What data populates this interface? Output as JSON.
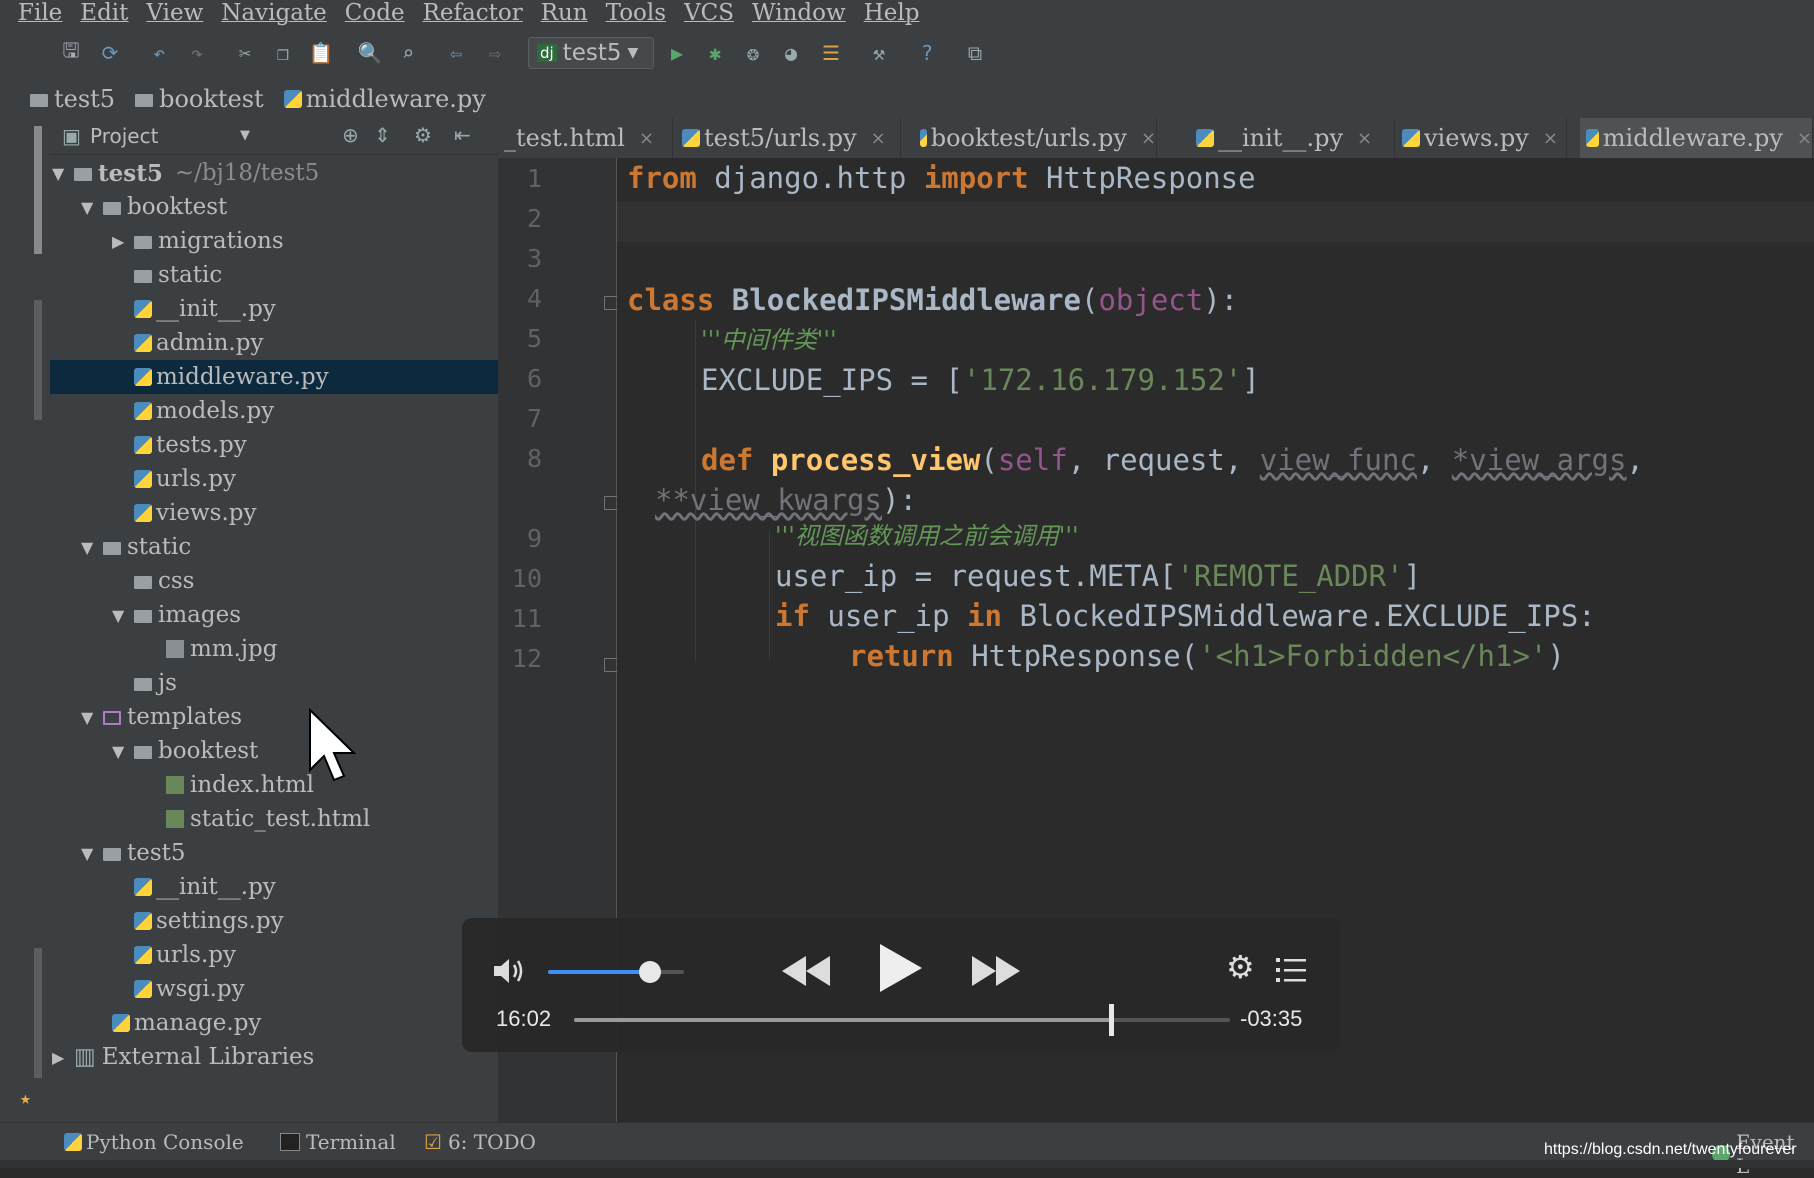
{
  "menu": [
    "File",
    "Edit",
    "View",
    "Navigate",
    "Code",
    "Refactor",
    "Run",
    "Tools",
    "VCS",
    "Window",
    "Help"
  ],
  "toolbar": {
    "run_config": "test5"
  },
  "breadcrumb": [
    "test5",
    "booktest",
    "middleware.py"
  ],
  "project": {
    "title": "Project",
    "tree": [
      {
        "label": "test5",
        "extra": "~/bj18/test5"
      },
      {
        "label": "booktest"
      },
      {
        "label": "migrations"
      },
      {
        "label": "static"
      },
      {
        "label": "__init__.py"
      },
      {
        "label": "admin.py"
      },
      {
        "label": "middleware.py"
      },
      {
        "label": "models.py"
      },
      {
        "label": "tests.py"
      },
      {
        "label": "urls.py"
      },
      {
        "label": "views.py"
      },
      {
        "label": "static"
      },
      {
        "label": "css"
      },
      {
        "label": "images"
      },
      {
        "label": "mm.jpg"
      },
      {
        "label": "js"
      },
      {
        "label": "templates"
      },
      {
        "label": "booktest"
      },
      {
        "label": "index.html"
      },
      {
        "label": "static_test.html"
      },
      {
        "label": "test5"
      },
      {
        "label": "__init__.py"
      },
      {
        "label": "settings.py"
      },
      {
        "label": "urls.py"
      },
      {
        "label": "wsgi.py"
      },
      {
        "label": "manage.py"
      },
      {
        "label": "External Libraries"
      }
    ]
  },
  "tabs": [
    "_test.html",
    "test5/urls.py",
    "booktest/urls.py",
    "__init__.py",
    "views.py",
    "middleware.py"
  ],
  "editor": {
    "line_numbers": [
      "1",
      "2",
      "3",
      "4",
      "5",
      "6",
      "7",
      "8",
      "9",
      "10",
      "11",
      "12"
    ],
    "t": {
      "l1a": "from",
      "l1b": " django.http ",
      "l1c": "import",
      "l1d": " HttpResponse",
      "l4a": "class",
      "l4b": " BlockedIPSMiddleware",
      "l4c": "(",
      "l4d": "object",
      "l4e": "):",
      "l5": "'''中间件类'''",
      "l6a": "EXCLUDE_IPS = [",
      "l6b": "'172.16.179.152'",
      "l6c": "]",
      "l8a": "def",
      "l8b": " process_view",
      "l8c": "(",
      "l8d": "self",
      "l8e": ", request, ",
      "l8f": "view_func",
      "l8g": ", ",
      "l8h": "*view_args",
      "l8i": ",",
      "l8j": "**view_kwargs",
      "l8k": "):",
      "l9": "'''视图函数调用之前会调用'''",
      "l10a": "user_ip = request.META[",
      "l10b": "'REMOTE_ADDR'",
      "l10c": "]",
      "l11a": "if",
      "l11b": " user_ip ",
      "l11c": "in",
      "l11d": " BlockedIPSMiddleware.EXCLUDE_IPS:",
      "l12a": "return",
      "l12b": " HttpResponse(",
      "l12c": "'<h1>Forbidden</h1>'",
      "l12d": ")"
    }
  },
  "player": {
    "elapsed": "16:02",
    "remaining": "-03:35",
    "volume": 0.75,
    "progress": 0.818
  },
  "bottom": {
    "python_console": "Python Console",
    "terminal": "Terminal",
    "todo": "6: TODO",
    "event": "Event L",
    "watermark": "https://blog.csdn.net/twentyfourever"
  }
}
